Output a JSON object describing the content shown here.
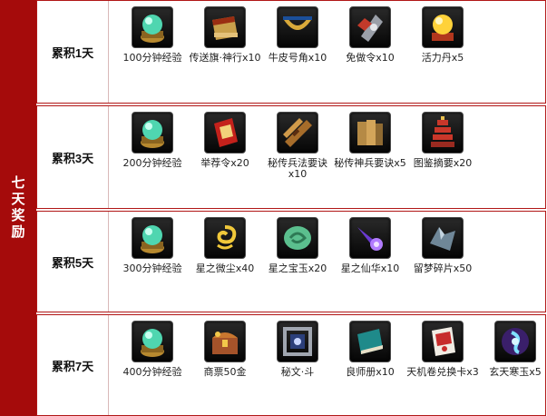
{
  "side_title": "七天奖励",
  "colors": {
    "accent": "#a50b0b",
    "border": "#b11616"
  },
  "rows": [
    {
      "day_label": "累积1天",
      "items": [
        {
          "label": "100分钟经验",
          "icon": "jade-orb-icon"
        },
        {
          "label": "传送旗·神行x10",
          "icon": "banner-scroll-icon"
        },
        {
          "label": "牛皮号角x10",
          "icon": "horn-icon"
        },
        {
          "label": "免做令x10",
          "icon": "token-plate-icon"
        },
        {
          "label": "活力丹x5",
          "icon": "golden-pill-icon"
        }
      ]
    },
    {
      "day_label": "累积3天",
      "items": [
        {
          "label": "200分钟经验",
          "icon": "jade-orb-icon"
        },
        {
          "label": "举荐令x20",
          "icon": "red-decree-icon"
        },
        {
          "label": "秘传兵法要诀x10",
          "icon": "scroll-bundle-icon"
        },
        {
          "label": "秘传神兵要诀x5",
          "icon": "book-scroll-icon"
        },
        {
          "label": "图鉴摘要x20",
          "icon": "pagoda-icon"
        }
      ]
    },
    {
      "day_label": "累积5天",
      "items": [
        {
          "label": "300分钟经验",
          "icon": "jade-orb-icon"
        },
        {
          "label": "星之微尘x40",
          "icon": "gold-swirl-icon"
        },
        {
          "label": "星之宝玉x20",
          "icon": "green-jade-icon"
        },
        {
          "label": "星之仙华x10",
          "icon": "purple-comet-icon"
        },
        {
          "label": "留梦碎片x50",
          "icon": "crystal-shard-icon"
        }
      ]
    },
    {
      "day_label": "累积7天",
      "items": [
        {
          "label": "400分钟经验",
          "icon": "jade-orb-icon"
        },
        {
          "label": "商票50金",
          "icon": "treasure-chest-icon"
        },
        {
          "label": "秘文·斗",
          "icon": "rune-frame-icon"
        },
        {
          "label": "良师册x10",
          "icon": "teal-book-icon"
        },
        {
          "label": "天机卷兑换卡x3",
          "icon": "exchange-card-icon"
        },
        {
          "label": "玄天寒玉x5",
          "icon": "ice-jade-icon"
        }
      ]
    }
  ]
}
